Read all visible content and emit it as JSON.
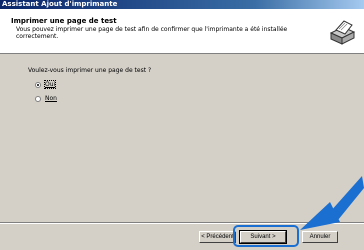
{
  "window": {
    "title": "Assistant Ajout d'imprimante"
  },
  "header": {
    "title": "Imprimer une page de test",
    "subtitle": "Vous pouvez imprimer une page de test afin de confirmer que l'imprimante a été installée correctement.",
    "icon": "printer-icon"
  },
  "main": {
    "question": "Voulez-vous imprimer une page de test ?",
    "options": [
      {
        "label": "Oui",
        "selected": true
      },
      {
        "label": "Non",
        "selected": false
      }
    ]
  },
  "buttons": {
    "back_label": "< Précédent",
    "next_label": "Suivant >",
    "cancel_label": "Annuler"
  },
  "annotation": {
    "arrow_color": "#1b6fd1",
    "highlight_color": "#1b6fd1"
  }
}
